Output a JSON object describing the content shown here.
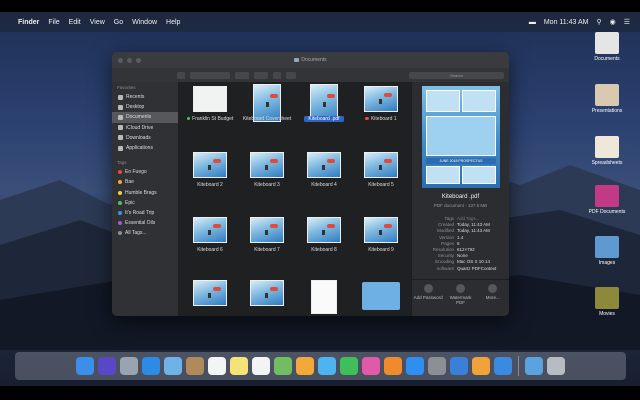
{
  "menubar": {
    "apple": "",
    "items": [
      "Finder",
      "File",
      "Edit",
      "View",
      "Go",
      "Window",
      "Help"
    ],
    "clock": "Mon 11:43 AM"
  },
  "desktop": {
    "items": [
      {
        "label": "Documents",
        "color": "#e5e5e5"
      },
      {
        "label": "Presentations",
        "color": "#d9c9b0"
      },
      {
        "label": "Spreadsheets",
        "color": "#efe8d8"
      },
      {
        "label": "PDF Documents",
        "color": "#c23a86"
      },
      {
        "label": "Images",
        "color": "#5e9ad0"
      },
      {
        "label": "Movies",
        "color": "#8c8a3a"
      }
    ]
  },
  "window": {
    "title": "Documents",
    "search_placeholder": "Search"
  },
  "sidebar": {
    "favorites_header": "Favorites",
    "favorites": [
      {
        "label": "Recents",
        "active": false
      },
      {
        "label": "Desktop",
        "active": false
      },
      {
        "label": "Documents",
        "active": true
      },
      {
        "label": "iCloud Drive",
        "active": false
      },
      {
        "label": "Downloads",
        "active": false
      },
      {
        "label": "Applications",
        "active": false
      }
    ],
    "tags_header": "Tags",
    "tags": [
      {
        "label": "En Fuego",
        "color": "#e8493a"
      },
      {
        "label": "Bae",
        "color": "#f0a63a"
      },
      {
        "label": "Humble Brags",
        "color": "#f2d23a"
      },
      {
        "label": "Epic",
        "color": "#4cc25a"
      },
      {
        "label": "It's Road Trip",
        "color": "#3d8ff0"
      },
      {
        "label": "Essential Oils",
        "color": "#a65ad6"
      },
      {
        "label": "All Tags...",
        "color": "#8d8e91"
      }
    ]
  },
  "files": [
    {
      "name": "Franklin St Budget",
      "tag": "#4cc25a",
      "kind": "budget"
    },
    {
      "name": "Kiteboard Coversheet",
      "tag": "",
      "kind": "tall"
    },
    {
      "name": "Kiteboard .pdf",
      "tag": "",
      "kind": "tall",
      "selected": true
    },
    {
      "name": "Kiteboard 1",
      "tag": "#e8493a",
      "kind": "photo"
    },
    {
      "name": "Kiteboard 2",
      "tag": "",
      "kind": "photo"
    },
    {
      "name": "Kiteboard 3",
      "tag": "",
      "kind": "photo"
    },
    {
      "name": "Kiteboard 4",
      "tag": "",
      "kind": "photo"
    },
    {
      "name": "Kiteboard 5",
      "tag": "",
      "kind": "photo"
    },
    {
      "name": "Kiteboard 6",
      "tag": "",
      "kind": "photo"
    },
    {
      "name": "Kiteboard 7",
      "tag": "",
      "kind": "photo"
    },
    {
      "name": "Kiteboard 8",
      "tag": "",
      "kind": "photo"
    },
    {
      "name": "Kiteboard 9",
      "tag": "",
      "kind": "photo"
    },
    {
      "name": "",
      "tag": "",
      "kind": "photo"
    },
    {
      "name": "",
      "tag": "",
      "kind": "photo"
    },
    {
      "name": "",
      "tag": "",
      "kind": "doc"
    },
    {
      "name": "",
      "tag": "",
      "kind": "folder"
    }
  ],
  "preview": {
    "name": "Kiteboard .pdf",
    "kind": "PDF document - 137.5 MB",
    "banner": "JUNE 2018 PROSPECTUS",
    "metadata": [
      {
        "key": "Tags",
        "value": "Add Tags...",
        "placeholder": true
      },
      {
        "key": "Created",
        "value": "Today, 11:43 AM"
      },
      {
        "key": "Modified",
        "value": "Today, 11:43 AM"
      },
      {
        "key": "Version",
        "value": "1.4"
      },
      {
        "key": "Pages",
        "value": "6"
      },
      {
        "key": "Resolution",
        "value": "612×792"
      },
      {
        "key": "Security",
        "value": "None"
      },
      {
        "key": "Encoding",
        "value": "Mac OS X 10.14"
      },
      {
        "key": "software",
        "value": "Quartz PDFContext"
      }
    ],
    "actions": [
      {
        "label": "Add Password",
        "icon": "lock-icon"
      },
      {
        "label": "Watermark PDF",
        "icon": "watermark-icon"
      },
      {
        "label": "More...",
        "icon": "more-icon"
      }
    ]
  },
  "dock": {
    "apps": [
      {
        "name": "finder",
        "color": "#3b8fe8"
      },
      {
        "name": "siri",
        "color": "#5a47c8"
      },
      {
        "name": "launchpad",
        "color": "#9aa4b0"
      },
      {
        "name": "safari",
        "color": "#2f8ae6"
      },
      {
        "name": "mail",
        "color": "#6fb2e8"
      },
      {
        "name": "contacts",
        "color": "#b08a5a"
      },
      {
        "name": "calendar",
        "color": "#f4f4f4"
      },
      {
        "name": "notes",
        "color": "#f5e37a"
      },
      {
        "name": "reminders",
        "color": "#f4f4f4"
      },
      {
        "name": "maps",
        "color": "#72bd62"
      },
      {
        "name": "photos",
        "color": "#f2a93a"
      },
      {
        "name": "messages",
        "color": "#4fb3f0"
      },
      {
        "name": "facetime",
        "color": "#3fbf5a"
      },
      {
        "name": "itunes",
        "color": "#e05aa8"
      },
      {
        "name": "books",
        "color": "#f08a2a"
      },
      {
        "name": "app-store",
        "color": "#2e8ff0"
      },
      {
        "name": "system-preferences",
        "color": "#8c8f95"
      },
      {
        "name": "keynote",
        "color": "#3a7fd8"
      },
      {
        "name": "pages",
        "color": "#f2a23a"
      },
      {
        "name": "xcode",
        "color": "#3a8ae0"
      }
    ],
    "right": [
      {
        "name": "downloads-folder",
        "color": "#5aa2e0"
      },
      {
        "name": "trash",
        "color": "#b8bcc2"
      }
    ]
  }
}
